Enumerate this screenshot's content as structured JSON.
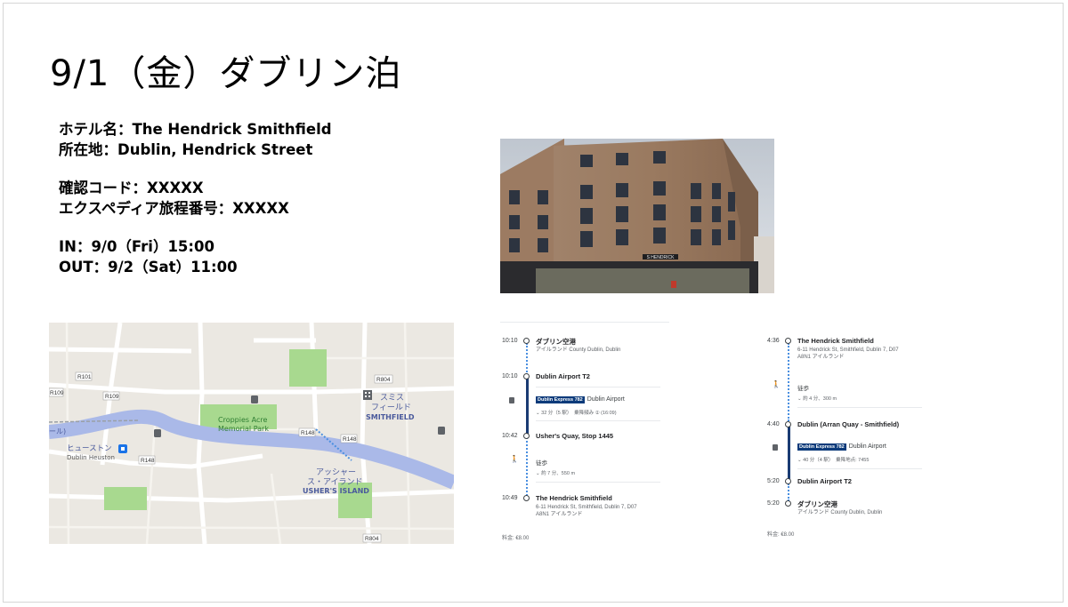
{
  "slide": {
    "title": "9/1（金）ダブリン泊",
    "info": {
      "hotel": "ホテル名：The Hendrick Smithfield",
      "location": "所在地：Dublin, Hendrick Street",
      "confirmation": "確認コード：XXXXX",
      "expedia": "エクスペディア旅程番号：XXXXX",
      "checkin": "IN：9/0（Fri）15:00",
      "checkout": "OUT：9/2（Sat）11:00"
    },
    "hotel_sign": "S HENDRICK"
  },
  "map": {
    "labels": {
      "r101": "R101",
      "r109": "R109",
      "r804_top": "R804",
      "r148_a": "R148",
      "r148_b": "R148",
      "r148_c": "R148",
      "r804_bottom": "R804",
      "park": "Croppies Acre\nMemorial Park",
      "park_l1": "Croppies Acre",
      "park_l2": "Memorial Park",
      "smithfield_jp1": "スミス",
      "smithfield_jp2": "フィールド",
      "smithfield": "SMITHFIELD",
      "heuston_jp": "ヒューストン",
      "heuston": "Dublin Heuston",
      "ushers_jp1": "アッシャー",
      "ushers_jp2": "ス・アイランド",
      "ushers": "USHER'S ISLAND",
      "left_edge_jp": "ール)"
    }
  },
  "route_left": {
    "stops": [
      {
        "time": "10:10",
        "name": "ダブリン空港",
        "addr": "アイルランド County Dublin, Dublin"
      },
      {
        "time": "10:10",
        "name": "Dublin Airport T2",
        "addr": ""
      },
      {
        "time": "10:42",
        "name": "Usher's Quay, Stop 1445",
        "addr": ""
      },
      {
        "time": "10:49",
        "name": "The Hendrick Smithfield",
        "addr": "6-11 Hendrick St, Smithfield, Dublin 7, D07\nA8N1 アイルランド"
      }
    ],
    "addr_last_l1": "6-11 Hendrick St, Smithfield, Dublin 7, D07",
    "addr_last_l2": "A8N1 アイルランド",
    "bus_badge": "Dublin Express 782",
    "bus_dest": "Dublin Airport",
    "bus_detail": "32 分（5 駅）　乗降頻み ② (16:09)",
    "walk": "徒歩",
    "walk_detail": "約 7 分、550 m",
    "fare": "料金: €8.00"
  },
  "route_right": {
    "stops": [
      {
        "time": "4:36",
        "name": "The Hendrick Smithfield",
        "addr_l1": "6-11 Hendrick St, Smithfield, Dublin 7, D07",
        "addr_l2": "A8N1 アイルランド"
      },
      {
        "time": "4:40",
        "name": "Dublin (Arran Quay - Smithfield)"
      },
      {
        "time": "5:20",
        "name": "Dublin Airport T2"
      },
      {
        "time": "5:20",
        "name": "ダブリン空港",
        "addr_l1": "アイルランド County Dublin, Dublin"
      }
    ],
    "walk": "徒歩",
    "walk_detail": "約 4 分、300 m",
    "bus_badge": "Dublin Express 782",
    "bus_dest": "Dublin Airport",
    "bus_detail": "40 分（4 駅）　乗降地点: 7455",
    "fare": "料金: €8.00"
  },
  "colors": {
    "bus_badge": "#0b3a7a",
    "river": "#aab9e8",
    "park": "#a8d98f",
    "route_line": "#1a3b73",
    "walk_dots": "#4a8fe0"
  }
}
